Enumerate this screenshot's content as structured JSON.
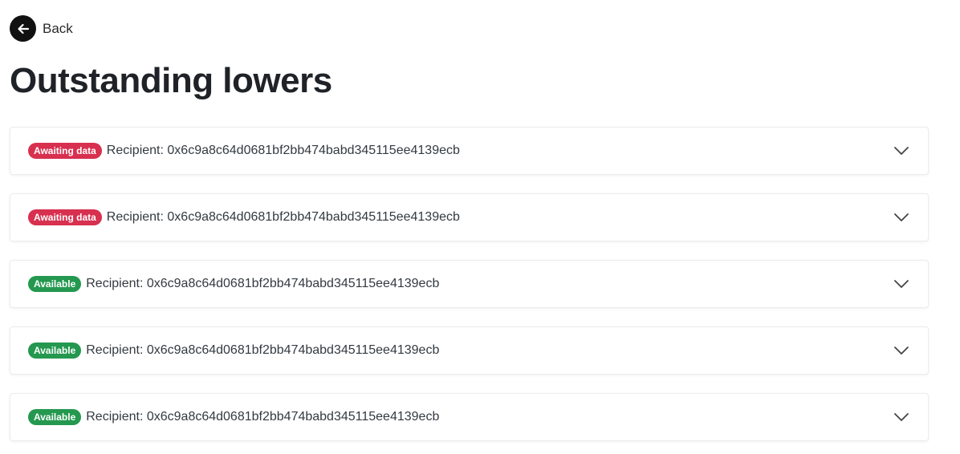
{
  "back": {
    "label": "Back"
  },
  "page": {
    "title": "Outstanding lowers"
  },
  "colors": {
    "awaiting": "#d8304f",
    "available": "#24984f"
  },
  "rows": [
    {
      "status": "Awaiting data",
      "status_kind": "awaiting",
      "recipient": "Recipient: 0x6c9a8c64d0681bf2bb474babd345115ee4139ecb"
    },
    {
      "status": "Awaiting data",
      "status_kind": "awaiting",
      "recipient": "Recipient: 0x6c9a8c64d0681bf2bb474babd345115ee4139ecb"
    },
    {
      "status": "Available",
      "status_kind": "available",
      "recipient": "Recipient: 0x6c9a8c64d0681bf2bb474babd345115ee4139ecb"
    },
    {
      "status": "Available",
      "status_kind": "available",
      "recipient": "Recipient: 0x6c9a8c64d0681bf2bb474babd345115ee4139ecb"
    },
    {
      "status": "Available",
      "status_kind": "available",
      "recipient": "Recipient: 0x6c9a8c64d0681bf2bb474babd345115ee4139ecb"
    }
  ],
  "icons": {
    "back": "arrow-left-icon",
    "expand": "chevron-down-icon"
  }
}
